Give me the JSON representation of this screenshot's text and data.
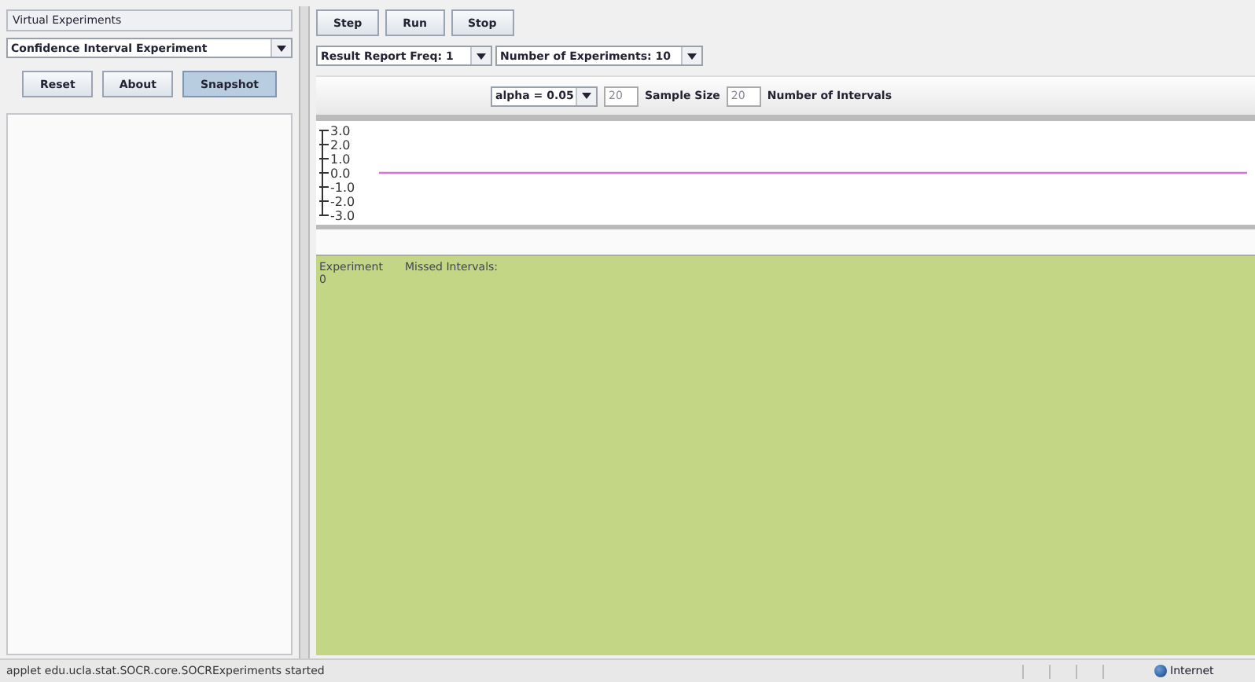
{
  "sidebar": {
    "title": "Virtual Experiments",
    "experiment_select": "Confidence Interval Experiment",
    "buttons": [
      {
        "label": "Reset",
        "selected": false
      },
      {
        "label": "About",
        "selected": false
      },
      {
        "label": "Snapshot",
        "selected": true
      }
    ]
  },
  "toolbar": {
    "buttons": [
      "Step",
      "Run",
      "Stop"
    ]
  },
  "options": {
    "report_freq": "Result Report Freq: 1",
    "experiments": "Number of Experiments: 10"
  },
  "parameters": {
    "alpha": "alpha = 0.05",
    "sample_size_value": "20",
    "sample_size_label": "Sample Size",
    "intervals_value": "20",
    "intervals_label": "Number of Intervals"
  },
  "chart": {
    "axis_labels": [
      "3.0",
      "2.0",
      "1.0",
      "0.0",
      "-1.0",
      "-2.0",
      "-3.0"
    ]
  },
  "results": {
    "columns": [
      "Experiment",
      "Missed Intervals:"
    ],
    "value": "0"
  },
  "status_bar": {
    "message": "applet edu.ucla.stat.SOCR.core.SOCRExperiments started",
    "zone": "Internet"
  }
}
